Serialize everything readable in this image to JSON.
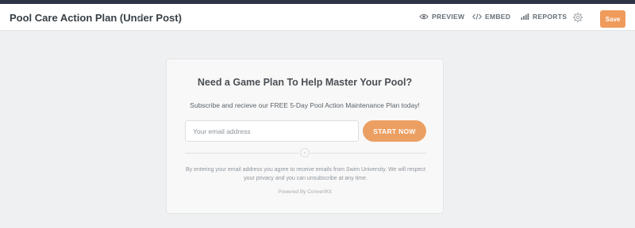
{
  "header": {
    "title": "Pool Care Action Plan (Under Post)",
    "nav": {
      "preview_label": "PREVIEW",
      "embed_label": "EMBED",
      "reports_label": "REPORTS"
    },
    "save_label": "Save"
  },
  "form": {
    "heading": "Need a Game Plan To Help Master Your Pool?",
    "subheading": "Subscribe and recieve our FREE 5-Day Pool Action Maintenance Plan today!",
    "email": {
      "placeholder": "Your email address",
      "value": ""
    },
    "submit_label": "START NOW",
    "disclaimer": "By entering your email address you agree to receive emails from Swim University. We will respect your privacy and you can unsubscribe at any time.",
    "powered_by": "Powered By ConvertKit"
  },
  "icons": {
    "title_edit": "pencil-icon",
    "preview": "eye-icon",
    "embed": "code-icon",
    "reports": "bar-chart-icon",
    "settings": "gear-icon"
  },
  "colors": {
    "accent": "#ef9b5c",
    "top_strip": "#2d3446",
    "background": "#eef0f2"
  }
}
